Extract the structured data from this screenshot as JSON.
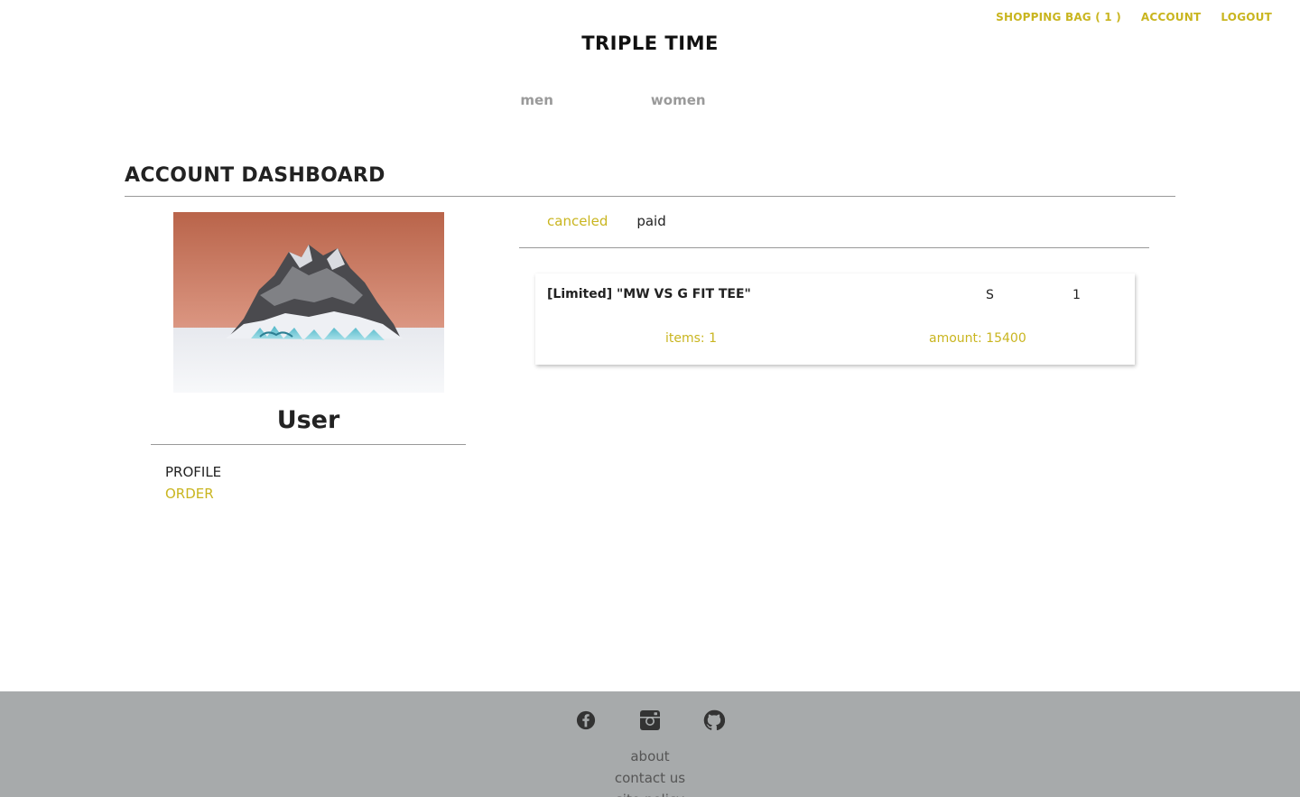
{
  "topnav": {
    "bag": "SHOPPING BAG ( 1 )",
    "account": "ACCOUNT",
    "logout": "LOGOUT"
  },
  "brand": "TRIPLE TIME",
  "categories": {
    "men": "men",
    "women": "women"
  },
  "dashboard": {
    "title": "ACCOUNT DASHBOARD"
  },
  "user": {
    "name": "User"
  },
  "side_menu": {
    "profile": "PROFILE",
    "order": "ORDER"
  },
  "status_tabs": {
    "canceled": "canceled",
    "paid": "paid"
  },
  "order": {
    "product_name": "[Limited] \"MW VS G FIT TEE\"",
    "size": "S",
    "quantity": "1",
    "items": "items: 1",
    "amount": "amount: 15400"
  },
  "footer": {
    "social_icons": [
      "facebook-icon",
      "instagram-icon",
      "github-icon"
    ],
    "links": {
      "about": "about",
      "contact": "contact us",
      "policy": "site policy"
    }
  },
  "colors": {
    "accent": "#c9b51f",
    "footer_bg": "#a7aaab",
    "muted": "#9a9a9a"
  }
}
